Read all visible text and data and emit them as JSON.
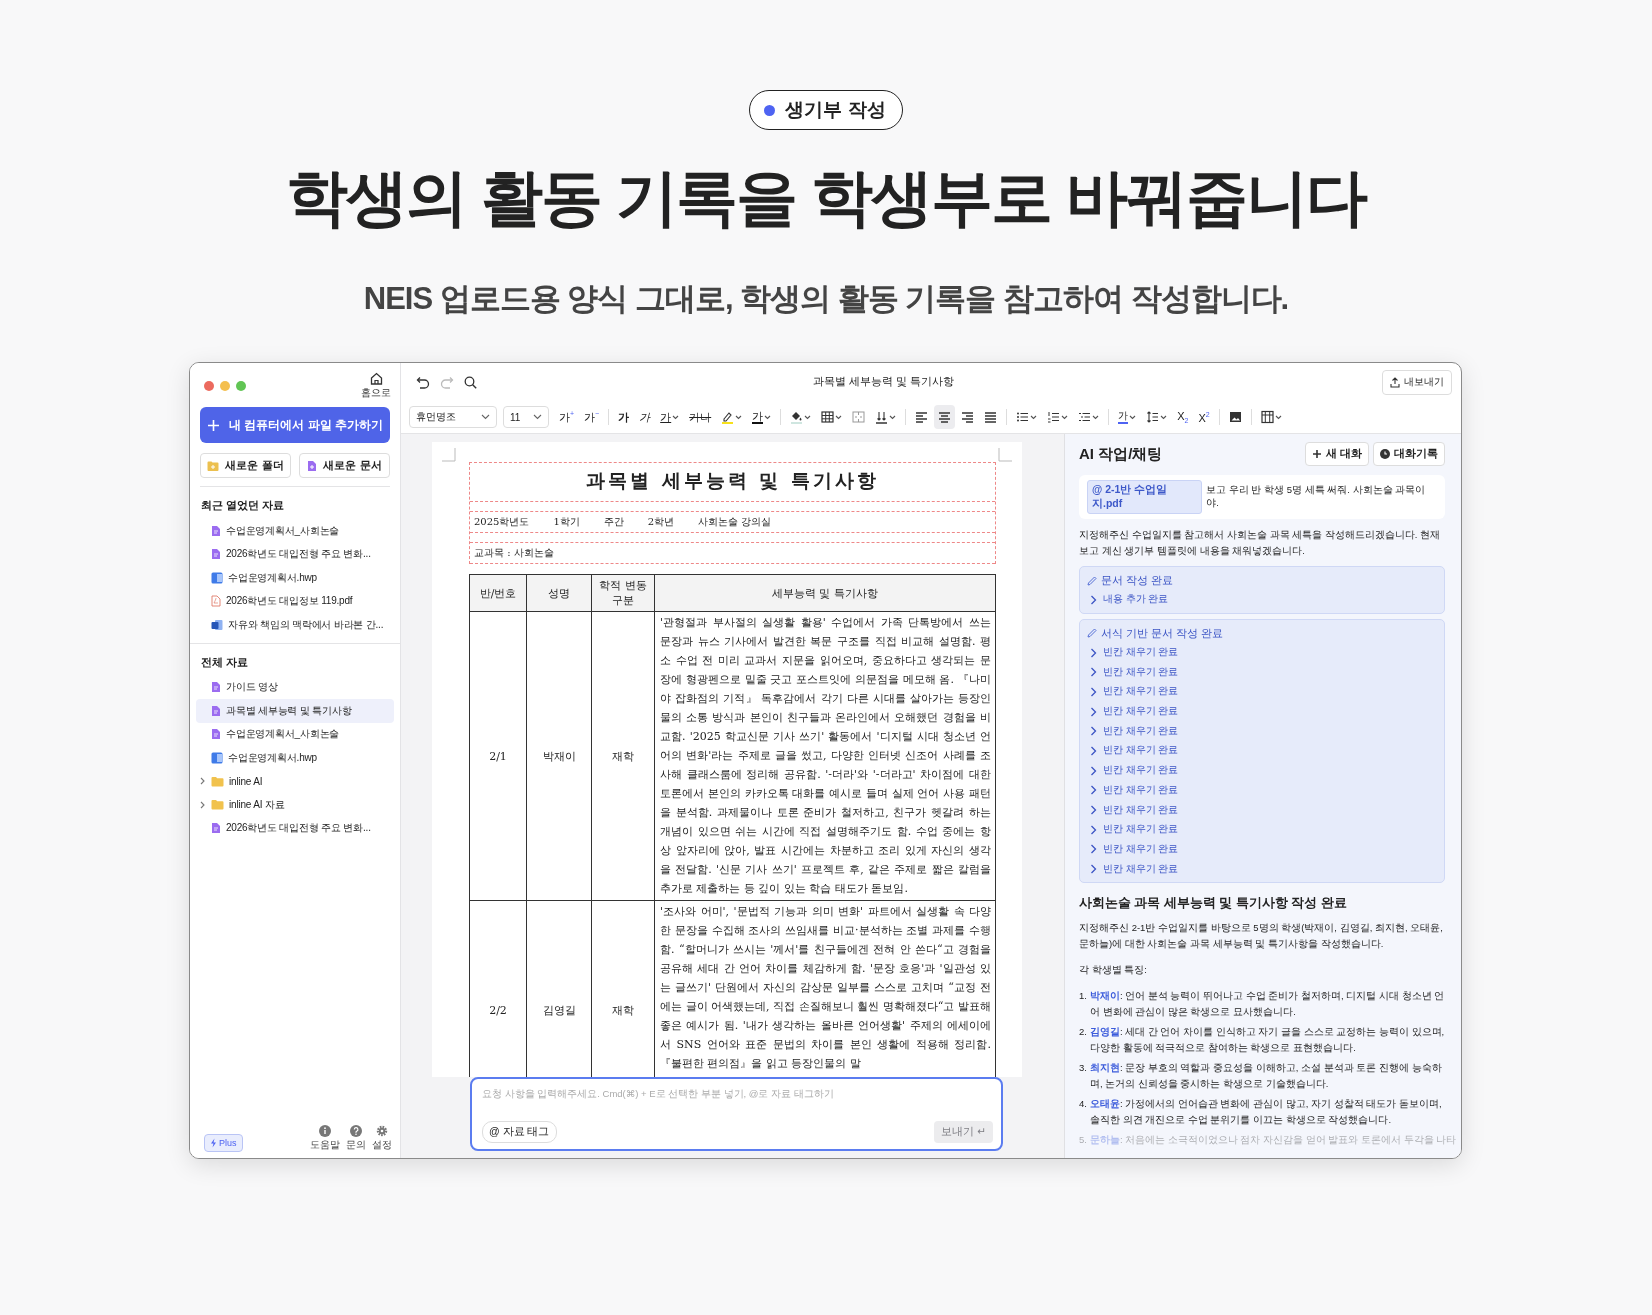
{
  "hero": {
    "badge": "생기부 작성",
    "title": "학생의 활동 기록을 학생부로 바꿔줍니다",
    "subtitle": "NEIS 업로드용 양식 그대로, 학생의 활동 기록을 참고하여 작성합니다."
  },
  "sidebar": {
    "home": "홈으로",
    "add_button": "내 컴퓨터에서 파일 추가하기",
    "new_folder": "새로운 폴더",
    "new_document": "새로운 문서",
    "recent": {
      "title": "최근 열었던 자료",
      "items": [
        {
          "kind": "doc",
          "label": "수업운영계획서_사회논술",
          "selected": false
        },
        {
          "kind": "doc",
          "label": "2026학년도 대입전형 주요 변화...",
          "selected": false
        },
        {
          "kind": "hwp",
          "label": "수업운영계획서.hwp",
          "selected": false
        },
        {
          "kind": "pdf",
          "label": "2026학년도 대입정보 119.pdf",
          "selected": false
        },
        {
          "kind": "word",
          "label": "자유와 책임의 맥락에서 바라본 간...",
          "selected": false
        }
      ]
    },
    "all": {
      "title": "전체 자료",
      "items": [
        {
          "kind": "doc",
          "label": "가이드 영상",
          "selected": false
        },
        {
          "kind": "doc",
          "label": "과목별 세부능력 및 특기사항",
          "selected": true
        },
        {
          "kind": "doc",
          "label": "수업운영계획서_사회논술",
          "selected": false
        },
        {
          "kind": "hwp",
          "label": "수업운영계획서.hwp",
          "selected": false
        },
        {
          "kind": "folder",
          "label": "inline AI",
          "selected": false,
          "expanded": false
        },
        {
          "kind": "folder",
          "label": "inline AI 자료",
          "selected": false,
          "expanded": false
        },
        {
          "kind": "doc",
          "label": "2026학년도 대입전형 주요 변화...",
          "selected": false
        }
      ]
    },
    "plan": "Plus",
    "footer": [
      {
        "kind": "info",
        "label": "도움말"
      },
      {
        "kind": "help",
        "label": "문의"
      },
      {
        "kind": "settings",
        "label": "설정"
      }
    ]
  },
  "editor": {
    "title": "과목별 세부능력 및 특기사항",
    "export": "내보내기",
    "toolbar": [
      {
        "kind": "select",
        "text": "휴먼명조"
      },
      {
        "kind": "select",
        "text": "11"
      },
      {
        "kind": "text",
        "text": "가$^{+}$",
        "menu": false
      },
      {
        "kind": "text",
        "text": "가$^{−}$",
        "menu": false
      },
      {
        "kind": "sep"
      },
      {
        "kind": "text",
        "text": "가",
        "menu": false
      },
      {
        "kind": "text",
        "text": "가",
        "menu": false
      },
      {
        "kind": "text",
        "text": "가",
        "menu": true
      },
      {
        "kind": "text",
        "text": "가나",
        "menu": false
      },
      {
        "kind": "icon",
        "menu": true
      },
      {
        "kind": "text",
        "text": "가",
        "menu": true
      },
      {
        "kind": "sep"
      },
      {
        "kind": "icon",
        "menu": true
      },
      {
        "kind": "icon",
        "menu": true
      },
      {
        "kind": "icon",
        "menu": false
      },
      {
        "kind": "icon",
        "menu": true
      },
      {
        "kind": "sep"
      },
      {
        "kind": "icon",
        "menu": false,
        "selected": false
      },
      {
        "kind": "icon",
        "menu": false,
        "selected": true
      },
      {
        "kind": "icon",
        "menu": false,
        "selected": false
      },
      {
        "kind": "icon",
        "menu": false,
        "selected": false
      },
      {
        "kind": "sep"
      },
      {
        "kind": "icon",
        "menu": true
      },
      {
        "kind": "icon",
        "menu": true
      },
      {
        "kind": "icon",
        "menu": true
      },
      {
        "kind": "sep"
      },
      {
        "kind": "text",
        "text": "가",
        "menu": true
      },
      {
        "kind": "icon",
        "menu": true
      },
      {
        "kind": "text",
        "text": "X$_{2}$",
        "menu": false
      },
      {
        "kind": "text",
        "text": "X$^{2}$",
        "menu": false
      },
      {
        "kind": "sep"
      },
      {
        "kind": "icon",
        "menu": false
      },
      {
        "kind": "sep"
      },
      {
        "kind": "icon",
        "menu": true
      }
    ],
    "document": {
      "heading": "과목별 세부능력 및 특기사항",
      "meta": [
        "2025학년도",
        "1학기",
        "주간",
        "2학년",
        "사회논술 강의실"
      ],
      "subject": "교과목 : 사회논술",
      "columns": [
        "반/번호",
        "성명",
        "학적 변동구분",
        "세부능력 및 특기사항"
      ],
      "rows": [
        {
          "number": "2/1",
          "name": "박재이",
          "status": "재학",
          "text": "'관형절과 부사절의 실생활 활용' 수업에서 가족 단톡방에서 쓰는 문장과 뉴스 기사에서 발견한 복문 구조를 직접 비교해 설명함. 평소 수업 전 미리 교과서 지문을 읽어오며, 중요하다고 생각되는 문장에 형광펜으로 밑줄 긋고 포스트잇에 의문점을 메모해 옴. 『나미야 잡화점의 기적』 독후감에서 각기 다른 시대를 살아가는 등장인물의 소통 방식과 본인이 친구들과 온라인에서 오해했던 경험을 비교함. '2025 학교신문 기사 쓰기' 활동에서 '디지털 시대 청소년 언어의 변화'라는 주제로 글을 썼고, 다양한 인터넷 신조어 사례를 조사해 클래스룸에 정리해 공유함. '-더라'와 '-더라고' 차이점에 대한 토론에서 본인의 카카오톡 대화를 예시로 들며 실제 언어 사용 패턴을 분석함. 과제물이나 토론 준비가 철저하고, 친구가 헷갈려 하는 개념이 있으면 쉬는 시간에 직접 설명해주기도 함. 수업 중에는 항상 앞자리에 앉아, 발표 시간에는 차분하고 조리 있게 자신의 생각을 전달함. '신문 기사 쓰기' 프로젝트 후, 같은 주제로 짧은 칼럼을 추가로 제출하는 등 깊이 있는 학습 태도가 돋보임."
        },
        {
          "number": "2/2",
          "name": "김영길",
          "status": "재학",
          "text": "'조사와 어미', '문법적 기능과 의미 변화' 파트에서 실생활 속 다양한 문장을 수집해 조사의 쓰임새를 비교·분석하는 조별 과제를 수행함. “할머니가 쓰시는 '께서'를 친구들에겐 전혀 안 쓴다“고 경험을 공유해 세대 간 언어 차이를 체감하게 함. '문장 호응'과 '일관성 있는 글쓰기' 단원에서 자신의 감상문 일부를 스스로 고치며 “교정 전에는 글이 어색했는데, 직접 손질해보니 훨씬 명확해졌다“고 발표해 좋은 예시가 됨. '내가 생각하는 올바른 언어생활' 주제의 에세이에서 SNS 언어와 표준 문법의 차이를 본인 생활에 적용해 정리함. 『불편한 편의점』을 읽고 등장인물의 말"
        }
      ]
    },
    "prompt": {
      "placeholder": "요청 사항을 입력해주세요. Cmd(⌘) + E로 선택한 부분 넣기, @로 자료 태그하기",
      "tag_button": "@ 자료 태그",
      "send": "보내기 ↵",
      "send_disabled": true
    }
  },
  "chat": {
    "title": "AI 작업/채팅",
    "new_chat": "새 대화",
    "history": "대화기록",
    "user_message": {
      "attachment": "@ 2-1반 수업일지.pdf",
      "text": "보고 우리 반 학생 5명 세특 써줘. 사회논술 과목이야."
    },
    "reply": "지정해주신 수업일지를 참고해서 사회논술 과목 세특을 작성해드리겠습니다. 현재 보고 계신 생기부 템플릿에 내용을 채워넣겠습니다.",
    "tool_groups": [
      {
        "title": "문서 작성 완료",
        "steps": [
          "내용 추가 완료"
        ]
      },
      {
        "title": "서식 기반 문서 작성 완료",
        "steps": [
          "빈칸 채우기 완료",
          "빈칸 채우기 완료",
          "빈칸 채우기 완료",
          "빈칸 채우기 완료",
          "빈칸 채우기 완료",
          "빈칸 채우기 완료",
          "빈칸 채우기 완료",
          "빈칸 채우기 완료",
          "빈칸 채우기 완료",
          "빈칸 채우기 완료",
          "빈칸 채우기 완료",
          "빈칸 채우기 완료"
        ]
      }
    ],
    "summary_title": "사회논술 과목 세부능력 및 특기사항 작성 완료",
    "summary": "지정해주신 2-1반 수업일지를 바탕으로 5명의 학생(박재이, 김영길, 최지현, 오태윤, 문하늘)에 대한 사회논술 과목 세부능력 및 특기사항을 작성했습니다.",
    "traits_title": "각 학생별 특징:",
    "traits": [
      {
        "number": "1.",
        "text": "**박재이**: 언어 분석 능력이 뛰어나고 수업 준비가 철저하며, 디지털 시대 청소년 언어 변화에 관심이 많은 학생으로 묘사했습니다.",
        "faded": false
      },
      {
        "number": "2.",
        "text": "**김영길**: 세대 간 언어 차이를 인식하고 자기 글을 스스로 교정하는 능력이 있으며, 다양한 활동에 적극적으로 참여하는 학생으로 표현했습니다.",
        "faded": false
      },
      {
        "number": "3.",
        "text": "**최지현**: 문장 부호의 역할과 중요성을 이해하고, 소설 분석과 토론 진행에 능숙하며, 논거의 신뢰성을 중시하는 학생으로 기술했습니다.",
        "faded": false
      },
      {
        "number": "4.",
        "text": "**오태윤**: 가정에서의 언어습관 변화에 관심이 많고, 자기 성찰적 태도가 돋보이며, 솔직한 의견 개진으로 수업 분위기를 이끄는 학생으로 작성했습니다.",
        "faded": false
      },
      {
        "number": "5.",
        "text": "**문하늘**: 처음에는 소극적이었으나 점차 자신감을 얻어 발표와 토론에서 두각을 나타",
        "faded": true
      }
    ]
  }
}
